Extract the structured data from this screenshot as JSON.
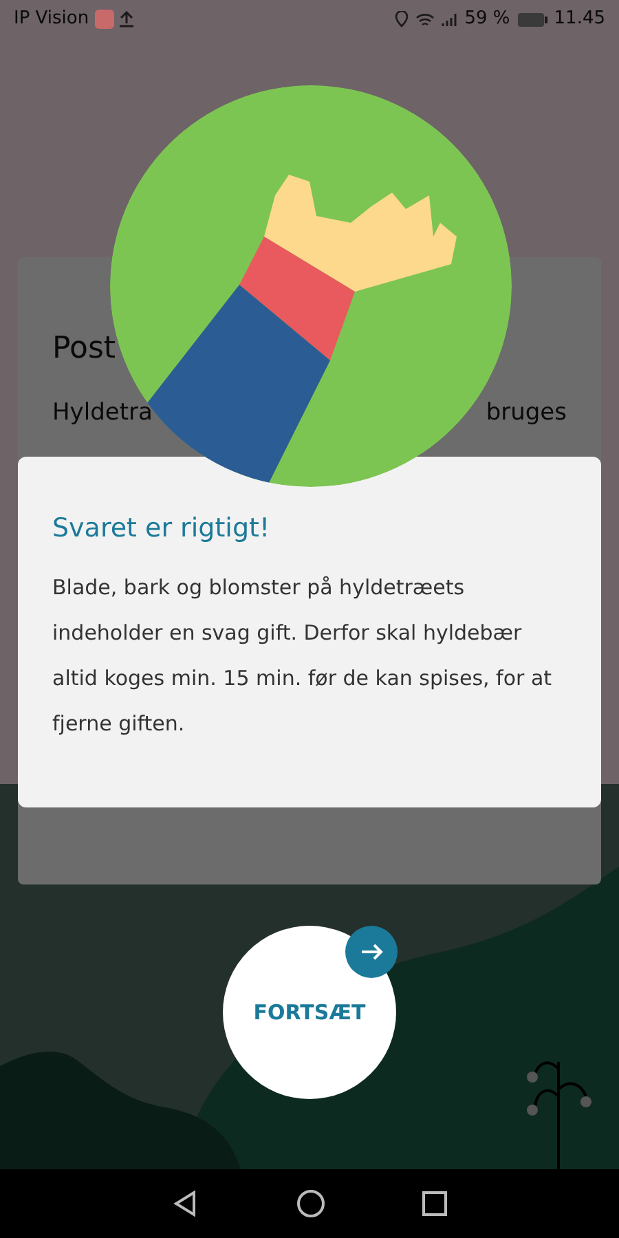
{
  "status_bar": {
    "carrier": "IP Vision",
    "battery": "59 %",
    "time": "11.45"
  },
  "question_card": {
    "title": "Post",
    "text_left": "Hyldetra",
    "text_right": "bruges"
  },
  "dialog": {
    "title": "Svaret er rigtigt!",
    "body": "Blade, bark og blomster på hyldetræets indeholder en svag gift. Derfor skal hyldebær altid koges min. 15 min. før de kan spises, for at fjerne giften."
  },
  "continue_button": {
    "label": "FORTSÆT"
  }
}
